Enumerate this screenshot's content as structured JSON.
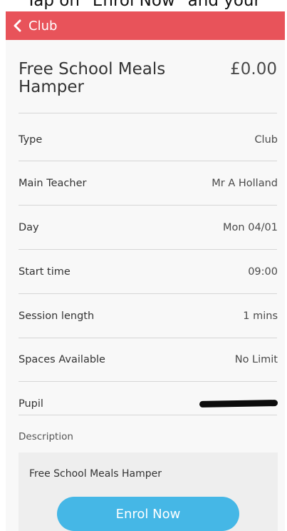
{
  "caption": "Tap on \"Enrol Now\" and your",
  "navbar": {
    "back_label": "Club",
    "bg_color": "#e8535a"
  },
  "header": {
    "title": "Free School Meals Hamper",
    "price": "£0.00"
  },
  "details": [
    {
      "label": "Type",
      "value": "Club"
    },
    {
      "label": "Main Teacher",
      "value": "Mr A Holland"
    },
    {
      "label": "Day",
      "value": "Mon 04/01"
    },
    {
      "label": "Start time",
      "value": "09:00"
    },
    {
      "label": "Session length",
      "value": "1 mins"
    },
    {
      "label": "Spaces Available",
      "value": "No Limit"
    }
  ],
  "pupil": {
    "label": "Pupil"
  },
  "description": {
    "label": "Description",
    "text": "Free School Meals Hamper"
  },
  "enrol_button": {
    "label": "Enrol Now",
    "color": "#45b7e6"
  }
}
